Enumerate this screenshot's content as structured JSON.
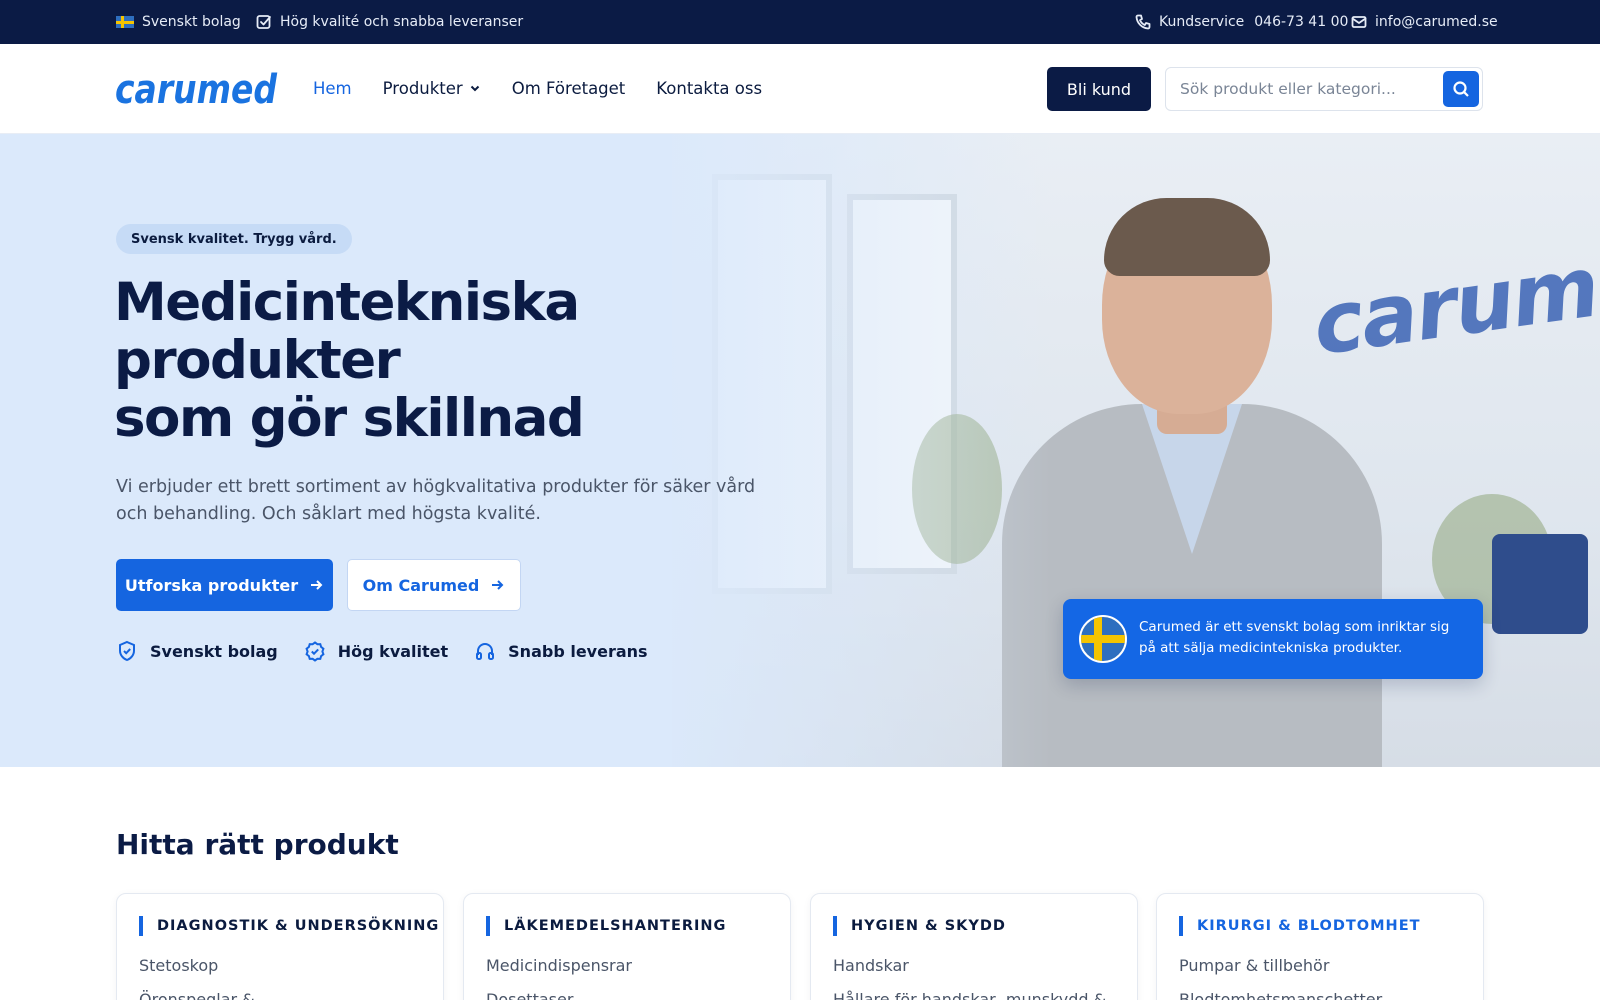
{
  "topbar": {
    "company_label": "Svenskt bolag",
    "quality_label": "Hög kvalité och snabba leveranser",
    "customer_service_label": "Kundservice",
    "phone": "046-73 41 00",
    "email": "info@carumed.se"
  },
  "header": {
    "logo_text": "carumed",
    "nav": {
      "home": "Hem",
      "products": "Produkter",
      "about": "Om Företaget",
      "contact": "Kontakta oss"
    },
    "cta_label": "Bli kund",
    "search": {
      "placeholder": "Sök produkt eller kategori...",
      "value": ""
    }
  },
  "hero": {
    "badge": "Svensk kvalitet. Trygg vård.",
    "title_line1": "Medicintekniska",
    "title_line2": "produkter",
    "title_line3": "som gör skillnad",
    "description": "Vi erbjuder ett brett sortiment av högkvalitativa produkter för säker vård och behandling. Och såklart med högsta kvalité.",
    "primary_button": "Utforska produkter",
    "secondary_button": "Om Carumed",
    "features": [
      "Svenskt bolag",
      "Hög kvalitet",
      "Snabb leverans"
    ],
    "info_card_text": "Carumed är ett svenskt bolag som inriktar sig på att sälja medicintekniska produkter.",
    "wall_logo_text": "carumed"
  },
  "products": {
    "section_title": "Hitta rätt produkt",
    "categories": [
      {
        "title": "DIAGNOSTIK & UNDERSÖKNING",
        "items": [
          "Stetoskop",
          "Öronspeglar &"
        ]
      },
      {
        "title": "LÄKEMEDELSHANTERING",
        "items": [
          "Medicindispensrar",
          "Dosettaser"
        ]
      },
      {
        "title": "HYGIEN & SKYDD",
        "items": [
          "Handskar",
          "Hållare för handskar, munskydd &"
        ]
      },
      {
        "title": "KIRURGI & BLODTOMHET",
        "items": [
          "Pumpar & tillbehör",
          "Blodtomhetsmanschetter"
        ]
      }
    ]
  },
  "colors": {
    "navy": "#0b1b45",
    "brand_blue": "#1565e0",
    "hero_bg": "#dbe9fb"
  }
}
